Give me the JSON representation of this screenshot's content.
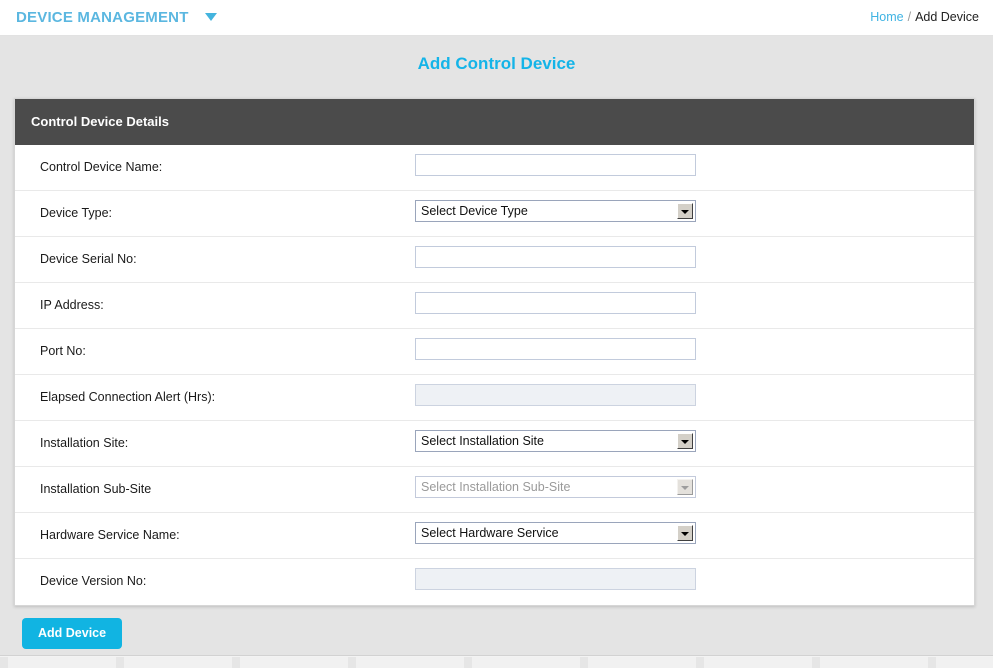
{
  "topbar": {
    "brand": "DEVICE MANAGEMENT",
    "brand_caret_icon": "chevron-down-icon",
    "breadcrumb": {
      "home": "Home",
      "separator": "/",
      "current": "Add Device"
    }
  },
  "page": {
    "title": "Add Control Device"
  },
  "panel": {
    "header": "Control Device Details",
    "rows": [
      {
        "label": "Control Device Name:",
        "type": "text",
        "value": "",
        "placeholder": "",
        "disabled": false
      },
      {
        "label": "Device Type:",
        "type": "select",
        "value": "Select Device Type",
        "disabled": false
      },
      {
        "label": "Device Serial No:",
        "type": "text",
        "value": "",
        "placeholder": "",
        "disabled": false
      },
      {
        "label": "IP Address:",
        "type": "text",
        "value": "",
        "placeholder": "",
        "disabled": false
      },
      {
        "label": "Port No:",
        "type": "text",
        "value": "",
        "placeholder": "",
        "disabled": false
      },
      {
        "label": "Elapsed Connection Alert (Hrs):",
        "type": "text",
        "value": "",
        "placeholder": "",
        "disabled": true
      },
      {
        "label": "Installation Site:",
        "type": "select",
        "value": "Select Installation Site",
        "disabled": false
      },
      {
        "label": "Installation Sub-Site",
        "type": "select",
        "value": "Select Installation Sub-Site",
        "disabled": true
      },
      {
        "label": "Hardware Service Name:",
        "type": "select",
        "value": "Select Hardware Service",
        "disabled": false
      },
      {
        "label": "Device Version No:",
        "type": "text",
        "value": "",
        "placeholder": "",
        "disabled": true
      }
    ]
  },
  "actions": {
    "submit_label": "Add Device"
  },
  "colors": {
    "accent": "#14b4e8",
    "brand": "#5bb7e0",
    "panel_header": "#4b4b4b",
    "page_background": "#e4e4e4",
    "button": "#11b4e2"
  }
}
